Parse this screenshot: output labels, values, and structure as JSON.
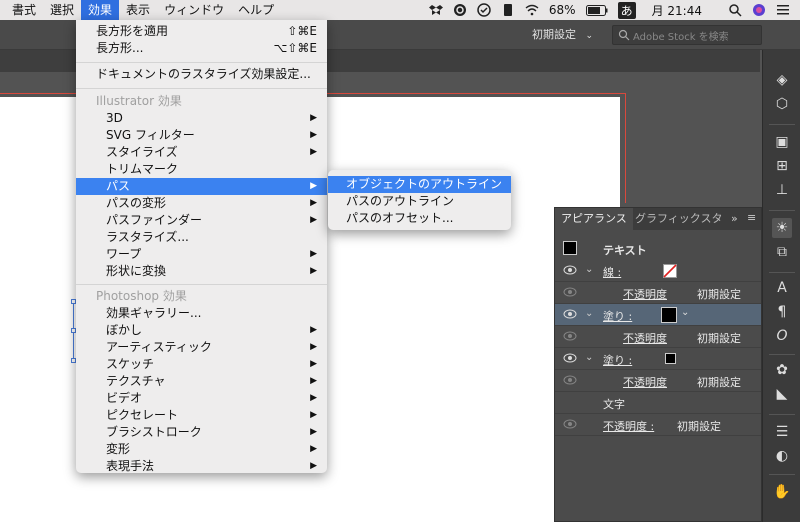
{
  "menubar": {
    "items": [
      "書式",
      "選択",
      "効果",
      "表示",
      "ウィンドウ",
      "ヘルプ"
    ],
    "active_index": 2,
    "battery": "68%",
    "input_mode": "あ",
    "clock": "月 21:44"
  },
  "controlbar": {
    "workspace": "初期設定",
    "stock_placeholder": "Adobe Stock を検索"
  },
  "effect_menu": {
    "apply_last": {
      "label": "長方形を適用",
      "shortcut": "⇧⌘E"
    },
    "last_effect": {
      "label": "長方形...",
      "shortcut": "⌥⇧⌘E"
    },
    "rasterize_settings": "ドキュメントのラスタライズ効果設定...",
    "illustrator_header": "Illustrator 効果",
    "illustrator_items": [
      "3D",
      "SVG フィルター",
      "スタイライズ",
      "トリムマーク",
      "パス",
      "パスの変形",
      "パスファインダー",
      "ラスタライズ...",
      "ワープ",
      "形状に変換"
    ],
    "photoshop_header": "Photoshop 効果",
    "photoshop_items": [
      "効果ギャラリー...",
      "ぼかし",
      "アーティスティック",
      "スケッチ",
      "テクスチャ",
      "ビデオ",
      "ピクセレート",
      "ブラシストローク",
      "変形",
      "表現手法"
    ]
  },
  "path_submenu": {
    "items": [
      "オブジェクトのアウトライン",
      "パスのアウトライン",
      "パスのオフセット..."
    ]
  },
  "appearance_panel": {
    "tabs": [
      "アピアランス",
      "グラフィックスタ"
    ],
    "object_type": "テキスト",
    "stroke_label": "線 :",
    "opacity_label": "不透明度",
    "opacity_value": "初期設定",
    "fill_label": "塗り :",
    "characters_label": "文字",
    "opacity_label_colon": "不透明度 :"
  },
  "colors": {
    "menu_highlight": "#3b82f0",
    "menubar_active": "#2f6fe0",
    "bleed_line": "#d8493d",
    "panel_selected_row": "#566677"
  }
}
